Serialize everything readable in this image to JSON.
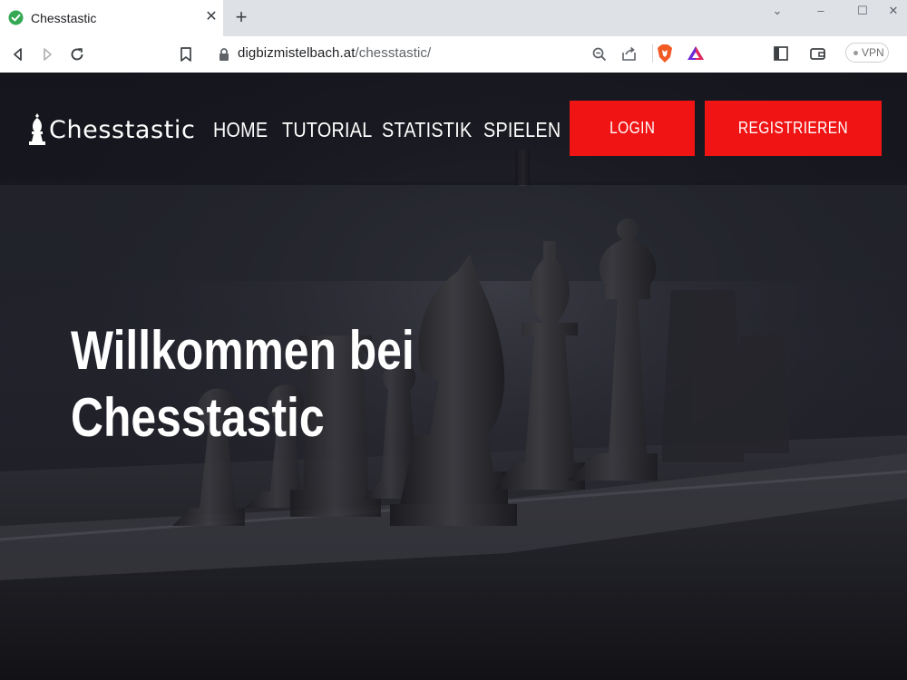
{
  "browser": {
    "tab": {
      "title": "Chesstastic",
      "favicon": "check-circle-icon",
      "favicon_color": "#34a853"
    },
    "url": {
      "host": "digbizmistelbach.at",
      "path": "/chesstastic/"
    },
    "vpn_label": "VPN"
  },
  "site": {
    "logo_text": "Chesstastic",
    "nav": [
      {
        "label": "HOME"
      },
      {
        "label": "TUTORIAL"
      },
      {
        "label": "STATISTIK"
      },
      {
        "label": "SPIELEN"
      }
    ],
    "login_label": "LOGIN",
    "register_label": "REGISTRIEREN",
    "accent_color": "#f01414"
  },
  "hero": {
    "title_line1": "Willkommen bei",
    "title_line2": "Chesstastic"
  }
}
